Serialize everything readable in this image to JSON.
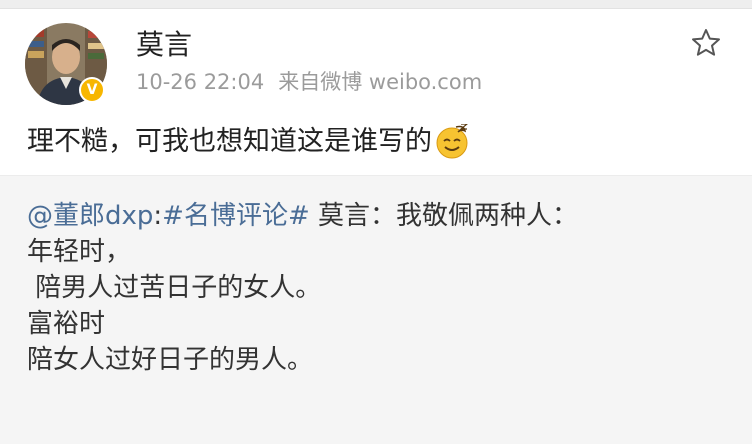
{
  "author": {
    "name": "莫言",
    "verified_badge": "V",
    "avatar_icon": "avatar-photo",
    "badge_color": "#f7b600"
  },
  "meta": {
    "timestamp": "10-26 22:04",
    "source": "来自微博 weibo.com"
  },
  "actions": {
    "favorite_icon": "star-outline-icon"
  },
  "post": {
    "text": "理不糙，可我也想知道这是谁写的",
    "emoji": "dizzy-smile-emoji"
  },
  "repost": {
    "mention": "@董郎dxp",
    "colon": ":",
    "hashtag": "#名博评论#",
    "lead": " 莫言：我敬佩两种人：",
    "lines": [
      "年轻时，",
      " 陪男人过苦日子的女人。",
      "富裕时",
      "陪女人过好日子的男人。"
    ],
    "link_color": "#4a6d96",
    "background": "#f5f5f5"
  }
}
